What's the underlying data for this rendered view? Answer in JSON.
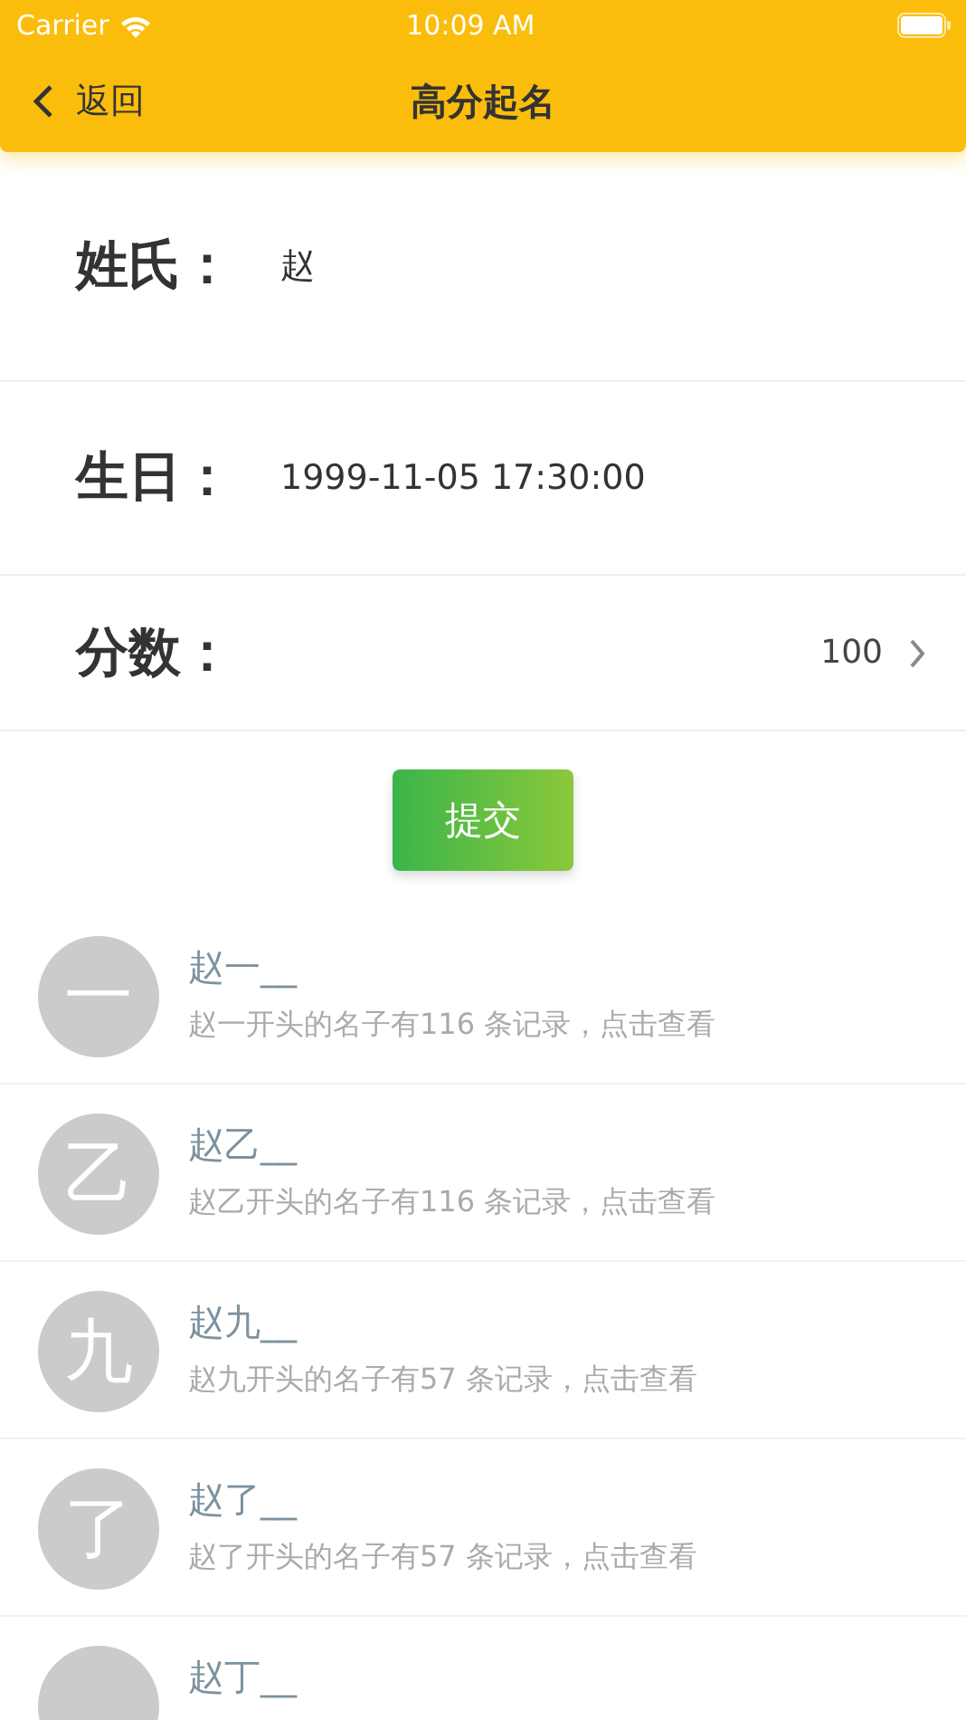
{
  "status_bar": {
    "carrier": "Carrier",
    "time": "10:09 AM"
  },
  "nav": {
    "back": "返回",
    "title": "高分起名"
  },
  "fields": [
    {
      "kind": "text",
      "label": "姓氏：",
      "value": "赵"
    },
    {
      "kind": "text",
      "label": "生日：",
      "value": "1999-11-05 17:30:00"
    },
    {
      "kind": "picker",
      "label": "分数：",
      "value": "100"
    }
  ],
  "submit": "提交",
  "results": [
    {
      "avatar": "一",
      "title": "赵一__",
      "subtitle": "赵一开头的名子有116 条记录，点击查看"
    },
    {
      "avatar": "乙",
      "title": "赵乙__",
      "subtitle": "赵乙开头的名子有116 条记录，点击查看"
    },
    {
      "avatar": "九",
      "title": "赵九__",
      "subtitle": "赵九开头的名子有57 条记录，点击查看"
    },
    {
      "avatar": "了",
      "title": "赵了__",
      "subtitle": "赵了开头的名子有57 条记录，点击查看"
    },
    {
      "title": "赵丁__"
    }
  ]
}
